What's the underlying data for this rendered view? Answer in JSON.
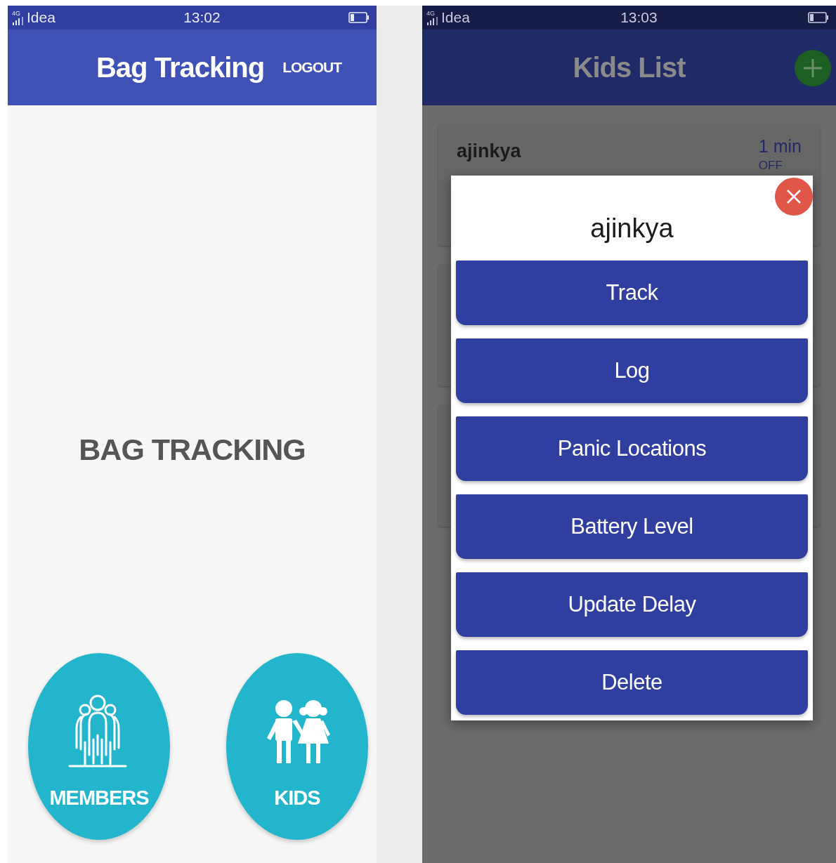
{
  "left_screen": {
    "status_bar": {
      "network": "4G",
      "carrier": "Idea",
      "time": "13:02"
    },
    "app_bar": {
      "title": "Bag Tracking",
      "action": "LOGOUT"
    },
    "heading": "BAG TRACKING",
    "tiles": [
      {
        "label": "MEMBERS",
        "kind": "members"
      },
      {
        "label": "KIDS",
        "kind": "kids"
      }
    ]
  },
  "right_screen": {
    "status_bar": {
      "network": "4G",
      "carrier": "Idea",
      "time": "13:03"
    },
    "app_bar": {
      "title": "Kids List"
    },
    "kids": [
      {
        "name": "ajinkya",
        "interval": "1 min",
        "status": "OFF"
      }
    ],
    "dialog": {
      "title": "ajinkya",
      "buttons": [
        "Track",
        "Log",
        "Panic Locations",
        "Battery Level",
        "Update Delay",
        "Delete"
      ]
    }
  }
}
